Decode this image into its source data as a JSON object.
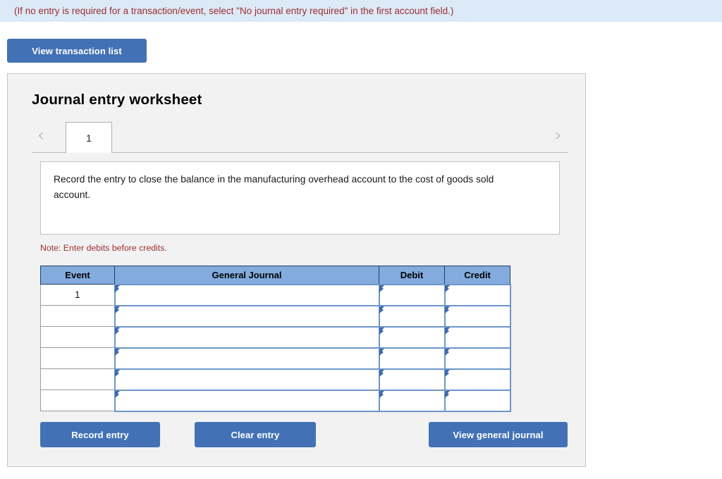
{
  "notice": {
    "text": "(If no entry is required for a transaction/event, select \"No journal entry required\" in the first account field.)",
    "background_color": "#dce9f7",
    "text_color": "#9c2f2f"
  },
  "toolbar": {
    "view_transaction_list_label": "View transaction list"
  },
  "worksheet": {
    "title": "Journal entry worksheet",
    "tabs": {
      "prev_arrow": "‹",
      "next_arrow": "›",
      "items": [
        {
          "label": "1",
          "active": true
        }
      ]
    },
    "instruction": "Record the entry to close the balance in the manufacturing overhead account to the cost of goods sold account.",
    "note": "Note: Enter debits before credits.",
    "table": {
      "headers": [
        "Event",
        "General Journal",
        "Debit",
        "Credit"
      ],
      "rows": [
        {
          "event": "1",
          "general_journal": "",
          "debit": "",
          "credit": ""
        },
        {
          "event": "",
          "general_journal": "",
          "debit": "",
          "credit": ""
        },
        {
          "event": "",
          "general_journal": "",
          "debit": "",
          "credit": ""
        },
        {
          "event": "",
          "general_journal": "",
          "debit": "",
          "credit": ""
        },
        {
          "event": "",
          "general_journal": "",
          "debit": "",
          "credit": ""
        },
        {
          "event": "",
          "general_journal": "",
          "debit": "",
          "credit": ""
        }
      ]
    },
    "actions": {
      "record_label": "Record entry",
      "clear_label": "Clear entry",
      "view_general_journal_label": "View general journal"
    }
  },
  "colors": {
    "button_blue": "#4272b5",
    "table_header_blue": "#83abde",
    "panel_background": "#f2f2f2",
    "input_border_blue": "#6d96c8",
    "accent_red": "#9c2f2f"
  }
}
